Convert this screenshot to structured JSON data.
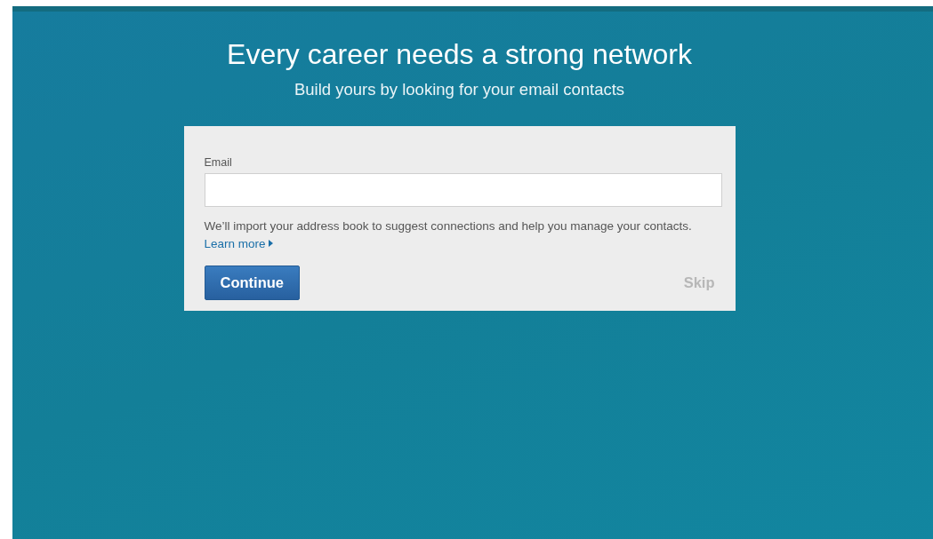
{
  "header": {
    "title": "Every career needs a strong network",
    "subtitle": "Build yours by looking for your email contacts"
  },
  "form": {
    "email_field": {
      "label": "Email"
    },
    "description": "We’ll import your address book to suggest connections and help you manage your contacts.",
    "learn_more_link": "Learn more",
    "buttons": [
      {
        "kind": "primary",
        "label": "Continue"
      },
      {
        "kind": "muted",
        "label": "Skip"
      }
    ]
  }
}
